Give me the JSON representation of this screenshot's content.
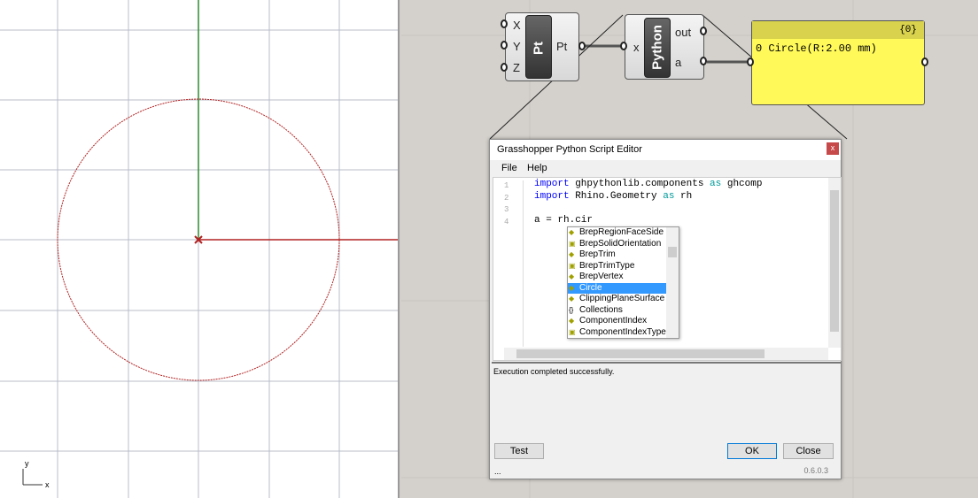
{
  "viewport": {
    "axis_y": "y",
    "axis_x": "x",
    "circle_color": "#b22222",
    "x_axis_color": "#b22222",
    "y_axis_color": "#2e8b2e"
  },
  "components": {
    "pt": {
      "inputs": [
        "X",
        "Y",
        "Z"
      ],
      "label": "Pt",
      "output": "Pt"
    },
    "python": {
      "input": "x",
      "label": "Python",
      "outputs": [
        "out",
        "a"
      ]
    },
    "panel": {
      "path": "{0}",
      "index": "0",
      "value": "Circle(R:2.00 mm)"
    }
  },
  "editor": {
    "title": "Grasshopper Python Script Editor",
    "close": "x",
    "menu": [
      "File",
      "Help"
    ],
    "line_numbers": [
      "1",
      "2",
      "3",
      "4"
    ],
    "code": [
      {
        "kw": "import",
        "rest": " ghpythonlib.components ",
        "kw2": "as",
        "tail": " ghcomp"
      },
      {
        "kw": "import",
        "rest": " Rhino.Geometry ",
        "kw2": "as",
        "tail": " rh"
      },
      {
        "kw": "",
        "rest": "",
        "kw2": "",
        "tail": ""
      },
      {
        "kw": "",
        "rest": "a = rh.cir",
        "kw2": "",
        "tail": ""
      }
    ],
    "autocomplete": [
      {
        "label": "BrepRegionFaceSide",
        "icon": "class-icon"
      },
      {
        "label": "BrepSolidOrientation",
        "icon": "enum-icon"
      },
      {
        "label": "BrepTrim",
        "icon": "class-icon"
      },
      {
        "label": "BrepTrimType",
        "icon": "enum-icon"
      },
      {
        "label": "BrepVertex",
        "icon": "class-icon"
      },
      {
        "label": "Circle",
        "icon": "class-icon",
        "selected": true
      },
      {
        "label": "ClippingPlaneSurface",
        "icon": "class-icon"
      },
      {
        "label": "Collections",
        "icon": "namespace-icon"
      },
      {
        "label": "ComponentIndex",
        "icon": "class-icon"
      },
      {
        "label": "ComponentIndexType",
        "icon": "enum-icon"
      }
    ],
    "output": "Execution completed successfully.",
    "buttons": {
      "test": "Test",
      "ok": "OK",
      "close": "Close"
    },
    "status": "...",
    "version": "0.6.0.3"
  }
}
